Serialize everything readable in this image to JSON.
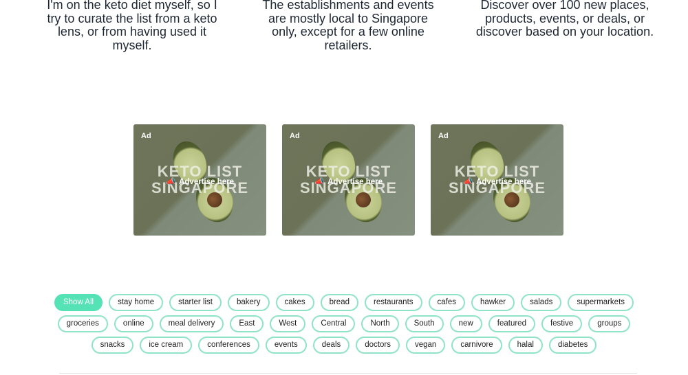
{
  "features": [
    {
      "text": "I'm on the keto diet myself, so I try to curate the list from a keto lens, or from having used it myself."
    },
    {
      "text": "The establishments and events are mostly local to Singapore only, except for a few online retailers."
    },
    {
      "text": "Discover over 100 new places, products, events, or deals, or discover based on your location."
    }
  ],
  "ads": [
    {
      "badge": "Ad",
      "title_line1": "KETO LIST",
      "title_line2": "SINGAPORE",
      "cta": "Advertise here",
      "cta_icon": "megaphone-icon"
    },
    {
      "badge": "Ad",
      "title_line1": "KETO LIST",
      "title_line2": "SINGAPORE",
      "cta": "Advertise here",
      "cta_icon": "megaphone-icon"
    },
    {
      "badge": "Ad",
      "title_line1": "KETO LIST",
      "title_line2": "SINGAPORE",
      "cta": "Advertise here",
      "cta_icon": "megaphone-icon"
    }
  ],
  "tags": {
    "active_color": "#55e2b4",
    "border_color": "#8fe3c9",
    "rows": [
      [
        "Show All",
        "stay home",
        "starter list",
        "bakery",
        "cakes",
        "bread",
        "restaurants",
        "cafes",
        "hawker",
        "salads",
        "supermarkets"
      ],
      [
        "groceries",
        "online",
        "meal delivery",
        "East",
        "West",
        "Central",
        "North",
        "South",
        "new",
        "featured",
        "festive",
        "groups"
      ],
      [
        "snacks",
        "ice cream",
        "conferences",
        "events",
        "deals",
        "doctors",
        "vegan",
        "carnivore",
        "halal",
        "diabetes"
      ]
    ]
  }
}
